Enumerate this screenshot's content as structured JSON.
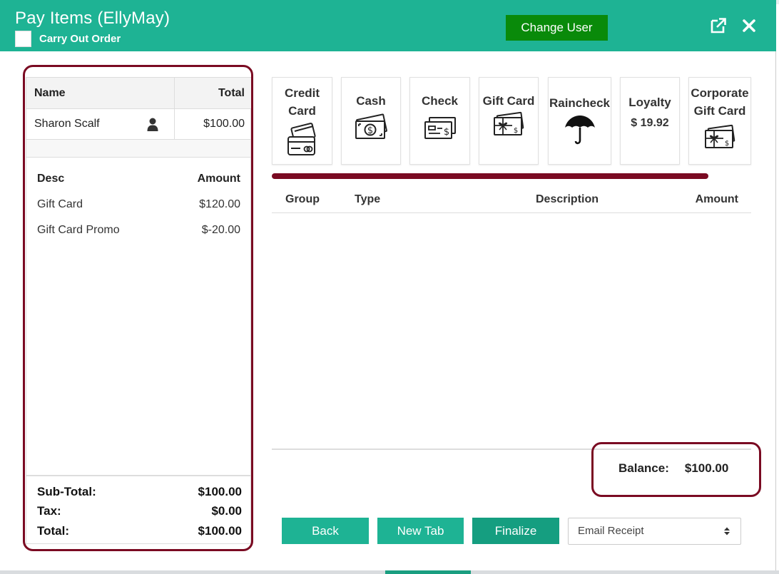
{
  "header": {
    "title": "Pay Items (EllyMay)",
    "carry_out_label": "Carry Out Order",
    "carry_out_checked": false,
    "change_user_label": "Change User",
    "expand_icon": "expand-icon",
    "close_icon": "close-icon",
    "background_color": "#1eb394"
  },
  "customer_table": {
    "headers": {
      "name": "Name",
      "total": "Total"
    },
    "rows": [
      {
        "name": "Sharon Scalf",
        "icon": "person-icon",
        "total": "$100.00"
      }
    ]
  },
  "items": {
    "headers": {
      "desc": "Desc",
      "amount": "Amount"
    },
    "rows": [
      {
        "desc": "Gift Card",
        "amount": "$120.00"
      },
      {
        "desc": "Gift Card Promo",
        "amount": "$-20.00"
      }
    ]
  },
  "totals": {
    "subtotal_label": "Sub-Total:",
    "subtotal_value": "$100.00",
    "tax_label": "Tax:",
    "tax_value": "$0.00",
    "total_label": "Total:",
    "total_value": "$100.00"
  },
  "tenders": [
    {
      "line1": "Credit",
      "line2": "Card",
      "icon": "credit-card-icon"
    },
    {
      "line1": "Cash",
      "icon": "cash-icon"
    },
    {
      "line1": "Check",
      "icon": "check-icon"
    },
    {
      "line1": "Gift Card",
      "icon": "gift-card-icon"
    },
    {
      "line1": "Raincheck",
      "icon": "umbrella-icon"
    },
    {
      "line1": "Loyalty",
      "value": "$ 19.92"
    },
    {
      "line1": "Corporate",
      "line2": "Gift Card",
      "icon": "gift-card-icon"
    }
  ],
  "payments_table": {
    "headers": {
      "group": "Group",
      "type": "Type",
      "description": "Description",
      "amount": "Amount"
    },
    "rows": []
  },
  "balance": {
    "label": "Balance:",
    "value": "$100.00"
  },
  "footer": {
    "back_label": "Back",
    "new_tab_label": "New Tab",
    "finalize_label": "Finalize",
    "receipt_select_value": "Email Receipt"
  },
  "colors": {
    "accent": "#1eb394",
    "change_user": "#098a0a",
    "annotation": "#7a0a22"
  }
}
